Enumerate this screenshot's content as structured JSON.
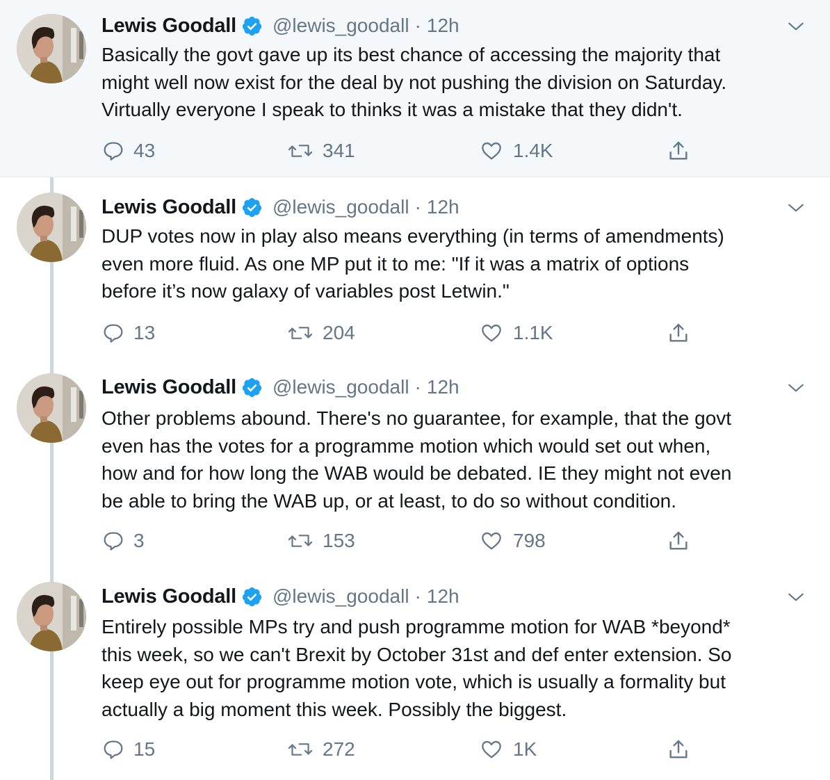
{
  "tweets": [
    {
      "author": "Lewis Goodall",
      "handle": "@lewis_goodall",
      "separator": "·",
      "time": "12h",
      "text": "Basically the govt gave up its best chance of accessing the majority that\nmight well now exist for the deal by not pushing the division on Saturday.\nVirtually everyone I speak to thinks it was a mistake that they didn't.",
      "replies": "43",
      "retweets": "341",
      "likes": "1.4K"
    },
    {
      "author": "Lewis Goodall",
      "handle": "@lewis_goodall",
      "separator": "·",
      "time": "12h",
      "text": "DUP votes now in play also means everything (in terms of amendments)\neven more fluid. As one MP put it to me: \"If it was a matrix of options\nbefore it’s now galaxy of variables post Letwin.\"",
      "replies": "13",
      "retweets": "204",
      "likes": "1.1K"
    },
    {
      "author": "Lewis Goodall",
      "handle": "@lewis_goodall",
      "separator": "·",
      "time": "12h",
      "text": "Other problems abound. There's no guarantee, for example, that the govt\neven has the votes for a programme motion which would set out when,\nhow and for how long the WAB would be debated. IE they might not even\nbe able to bring the WAB up, or at least, to do so without condition.",
      "replies": "3",
      "retweets": "153",
      "likes": "798"
    },
    {
      "author": "Lewis Goodall",
      "handle": "@lewis_goodall",
      "separator": "·",
      "time": "12h",
      "text": "Entirely possible MPs try and push programme motion for WAB *beyond*\nthis week, so we can't Brexit by October 31st and def enter extension. So\nkeep eye out for programme motion vote, which is usually a formality but\nactually a big moment this week. Possibly the biggest.",
      "replies": "15",
      "retweets": "272",
      "likes": "1K"
    }
  ],
  "icons": {
    "verified": "verified-badge-icon",
    "caret": "chevron-down-icon",
    "reply": "reply-icon",
    "retweet": "retweet-icon",
    "like": "heart-icon",
    "share": "share-icon"
  },
  "colors": {
    "verified": "#1da1f2",
    "secondary_text": "#657786",
    "thread_line": "#ccd6dd",
    "highlight_bg": "#f5f8fa"
  }
}
